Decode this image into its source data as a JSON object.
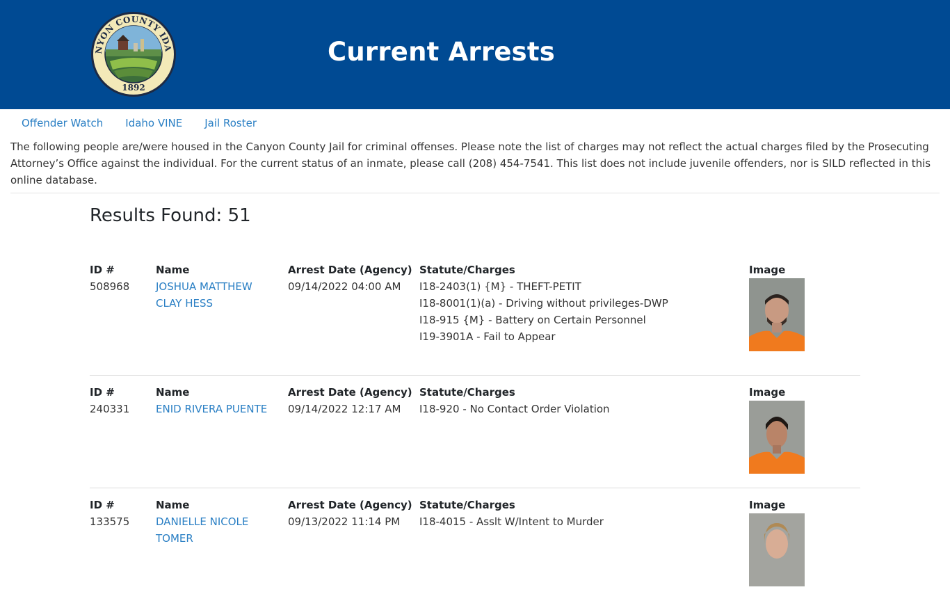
{
  "header": {
    "title": "Current Arrests"
  },
  "seal": {
    "top_text": "CANYON COUNTY IDAHO",
    "year": "1892"
  },
  "nav": [
    {
      "label": "Offender Watch"
    },
    {
      "label": "Idaho VINE"
    },
    {
      "label": "Jail Roster"
    }
  ],
  "intro": "The following people are/were housed in the Canyon County Jail for criminal offenses. Please note the list of charges may not reflect the actual charges filed by the Prosecuting Attorney’s Office against the individual. For the current status of an inmate, please call (208) 454-7541. This list does not include juvenile offenders, nor is SILD reflected in this online database.",
  "results": {
    "label": "Results Found: 51"
  },
  "columns": {
    "id": "ID #",
    "name": "Name",
    "date": "Arrest Date (Agency)",
    "charges": "Statute/Charges",
    "image": "Image"
  },
  "records": [
    {
      "id": "508968",
      "name": "JOSHUA MATTHEW CLAY HESS",
      "date": "09/14/2022 04:00 AM",
      "charges": [
        "I18-2403(1) {M} - THEFT-PETIT",
        "I18-8001(1)(a) - Driving without privileges-DWP",
        "I18-915 {M} - Battery on Certain Personnel",
        "I19-3901A - Fail to Appear"
      ]
    },
    {
      "id": "240331",
      "name": "ENID RIVERA PUENTE",
      "date": "09/14/2022 12:17 AM",
      "charges": [
        "I18-920 - No Contact Order Violation"
      ]
    },
    {
      "id": "133575",
      "name": "DANIELLE NICOLE TOMER",
      "date": "09/13/2022 11:14 PM",
      "charges": [
        "I18-4015 - Asslt W/Intent to Murder"
      ]
    }
  ],
  "colors": {
    "header_bg": "#004a93",
    "link": "#2a7fc4",
    "uniform": "#f07a1e"
  }
}
